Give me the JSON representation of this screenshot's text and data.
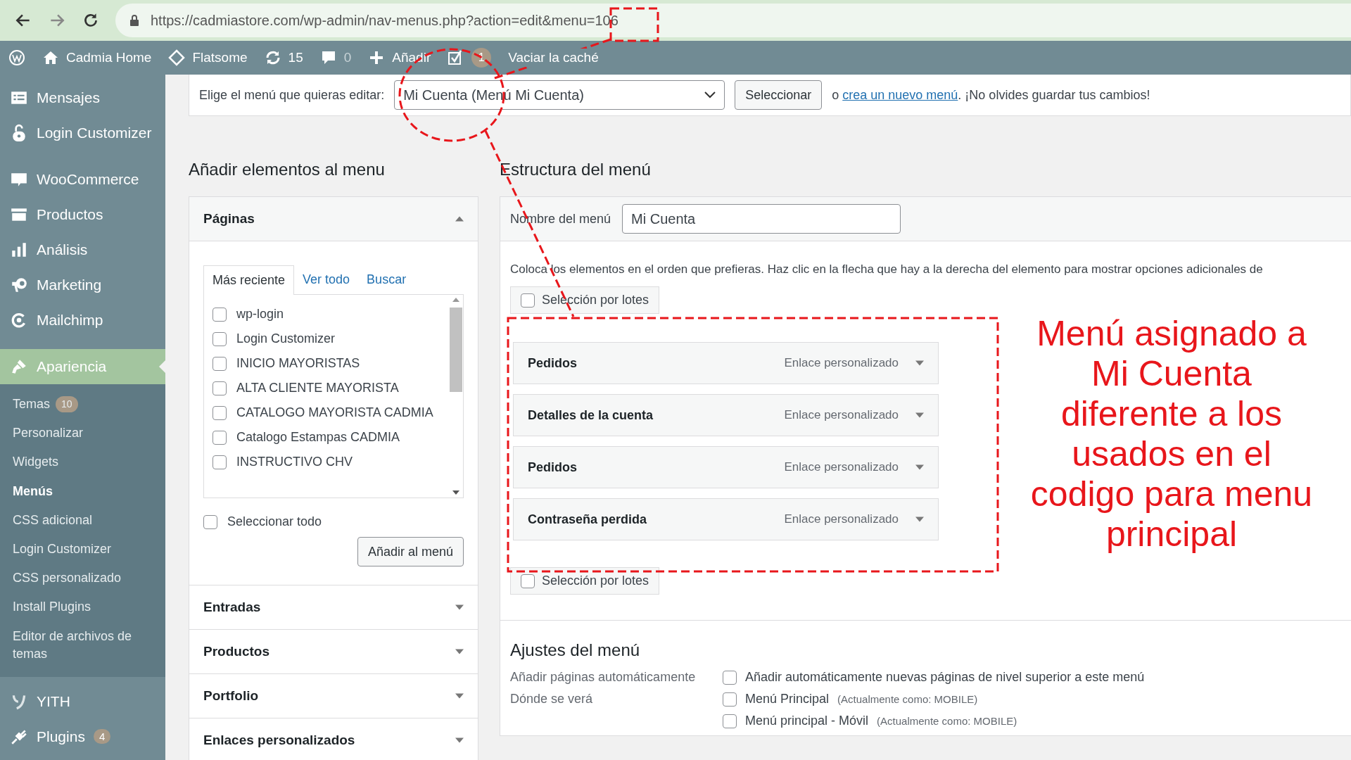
{
  "browser": {
    "url": "https://cadmiastore.com/wp-admin/nav-menus.php?action=edit&menu=106"
  },
  "admin_bar": {
    "items": [
      {
        "kind": "logo"
      },
      {
        "kind": "home",
        "label": "Cadmia Home"
      },
      {
        "kind": "theme",
        "label": "Flatsome"
      },
      {
        "kind": "updates",
        "label": "15"
      },
      {
        "kind": "comments",
        "label": "0"
      },
      {
        "kind": "new",
        "label": "Añadir"
      },
      {
        "kind": "seo",
        "label": "1"
      },
      {
        "kind": "text",
        "label": "Vaciar la caché"
      }
    ]
  },
  "sidebar": {
    "items": [
      {
        "label": "Mensajes",
        "selected": false
      },
      {
        "label": "Login Customizer",
        "selected": false
      },
      {
        "label": "WooCommerce",
        "selected": false
      },
      {
        "label": "Productos",
        "selected": false
      },
      {
        "label": "Análisis",
        "selected": false
      },
      {
        "label": "Marketing",
        "selected": false
      },
      {
        "label": "Mailchimp",
        "selected": false
      },
      {
        "label": "Apariencia",
        "selected": true,
        "children": [
          {
            "label": "Temas",
            "badge": "10",
            "selected": false
          },
          {
            "label": "Personalizar",
            "selected": false
          },
          {
            "label": "Widgets",
            "selected": false
          },
          {
            "label": "Menús",
            "selected": true
          },
          {
            "label": "CSS adicional",
            "selected": false
          },
          {
            "label": "Login Customizer",
            "selected": false
          },
          {
            "label": "CSS personalizado",
            "selected": false
          },
          {
            "label": "Install Plugins",
            "selected": false
          },
          {
            "label": "Editor de archivos de temas",
            "selected": false
          }
        ]
      },
      {
        "label": "YITH",
        "selected": false
      },
      {
        "label": "Plugins",
        "badge": "4",
        "selected": false
      }
    ]
  },
  "menu_select": {
    "label": "Elige el menú que quieras editar:",
    "value": "Mi Cuenta (Menú Mi Cuenta)",
    "button": "Seleccionar",
    "prefix": "o",
    "link": "crea un nuevo menú",
    "suffix": ". ¡No olvides guardar tus cambios!"
  },
  "add_items": {
    "title": "Añadir elementos al menu",
    "sections": [
      {
        "title": "Páginas",
        "expanded": true
      },
      {
        "title": "Entradas",
        "expanded": false
      },
      {
        "title": "Productos",
        "expanded": false
      },
      {
        "title": "Portfolio",
        "expanded": false
      },
      {
        "title": "Enlaces personalizados",
        "expanded": false
      }
    ],
    "tabs": [
      {
        "label": "Más reciente",
        "selected": true
      },
      {
        "label": "Ver todo",
        "selected": false
      },
      {
        "label": "Buscar",
        "selected": false
      }
    ],
    "pages": [
      {
        "label": "wp-login",
        "checked": false
      },
      {
        "label": "Login Customizer",
        "checked": false
      },
      {
        "label": "INICIO MAYORISTAS",
        "checked": false
      },
      {
        "label": "ALTA CLIENTE MAYORISTA",
        "checked": false
      },
      {
        "label": "CATALOGO MAYORISTA CADMIA",
        "checked": false
      },
      {
        "label": "Catalogo Estampas CADMIA",
        "checked": false
      },
      {
        "label": "INSTRUCTIVO CHV",
        "checked": false
      }
    ],
    "select_all": {
      "label": "Seleccionar todo",
      "checked": false
    },
    "add_button": "Añadir al menú"
  },
  "structure": {
    "title": "Estructura del menú",
    "name_label": "Nombre del menú",
    "name_value": "Mi Cuenta",
    "instructions": "Coloca los elementos en el orden que prefieras. Haz clic en la flecha que hay a la derecha del elemento para mostrar opciones adicionales de",
    "bulk_top": {
      "label": "Selección por lotes",
      "checked": false
    },
    "items": [
      {
        "title": "Pedidos",
        "type": "Enlace personalizado"
      },
      {
        "title": "Detalles de la cuenta",
        "type": "Enlace personalizado"
      },
      {
        "title": "Pedidos",
        "type": "Enlace personalizado"
      },
      {
        "title": "Contraseña perdida",
        "type": "Enlace personalizado"
      }
    ],
    "bulk_bottom": {
      "label": "Selección por lotes",
      "checked": false
    }
  },
  "settings": {
    "title": "Ajustes del menú",
    "rows": [
      {
        "label": "Añadir páginas automáticamente",
        "options": [
          {
            "label": "Añadir automáticamente nuevas páginas de nivel superior a este menú",
            "checked": false
          }
        ]
      },
      {
        "label": "Dónde se verá",
        "options": [
          {
            "label": "Menú Principal",
            "note": "(Actualmente como: MOBILE)",
            "checked": false
          },
          {
            "label": "Menú principal - Móvil",
            "note": "(Actualmente como: MOBILE)",
            "checked": false
          }
        ]
      }
    ]
  },
  "annotation": {
    "text": "Menú asignado a Mi Cuenta diferente a los usados en el codigo para menu principal"
  }
}
